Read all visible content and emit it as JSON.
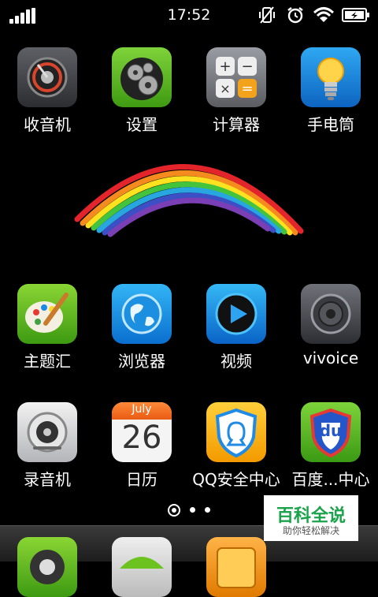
{
  "status_bar": {
    "time": "17:52",
    "icons": [
      "signal-icon",
      "vibrate-icon",
      "alarm-clock-icon",
      "wifi-icon",
      "battery-charging-icon"
    ]
  },
  "home": {
    "row1": [
      {
        "label": "收音机",
        "icon": "radio-icon"
      },
      {
        "label": "设置",
        "icon": "settings-gear-icon"
      },
      {
        "label": "计算器",
        "icon": "calculator-icon"
      },
      {
        "label": "手电筒",
        "icon": "flashlight-bulb-icon"
      }
    ],
    "row2": [
      {
        "label": "主题汇",
        "icon": "theme-palette-icon"
      },
      {
        "label": "浏览器",
        "icon": "browser-globe-icon"
      },
      {
        "label": "视频",
        "icon": "video-play-icon"
      },
      {
        "label": "vivoice",
        "icon": "speaker-icon"
      }
    ],
    "row3": [
      {
        "label": "录音机",
        "icon": "recorder-icon"
      },
      {
        "label": "日历",
        "icon": "calendar-icon",
        "month": "July",
        "day": "26"
      },
      {
        "label": "QQ安全中心",
        "icon": "qq-shield-icon"
      },
      {
        "label": "百度...中心",
        "icon": "baidu-shield-icon",
        "badge_text": "du"
      }
    ]
  },
  "pager": {
    "pages": 3,
    "current": 1
  },
  "dock": [
    "phone-dial-icon",
    "green-app-icon",
    "orange-folder-icon",
    "yellow-app-icon"
  ],
  "watermark": {
    "title": "百科全说",
    "subtitle": "助你轻松解决"
  },
  "colors": {
    "background": "#000000",
    "label": "#ffffff",
    "watermark_green": "#1aa34a"
  }
}
